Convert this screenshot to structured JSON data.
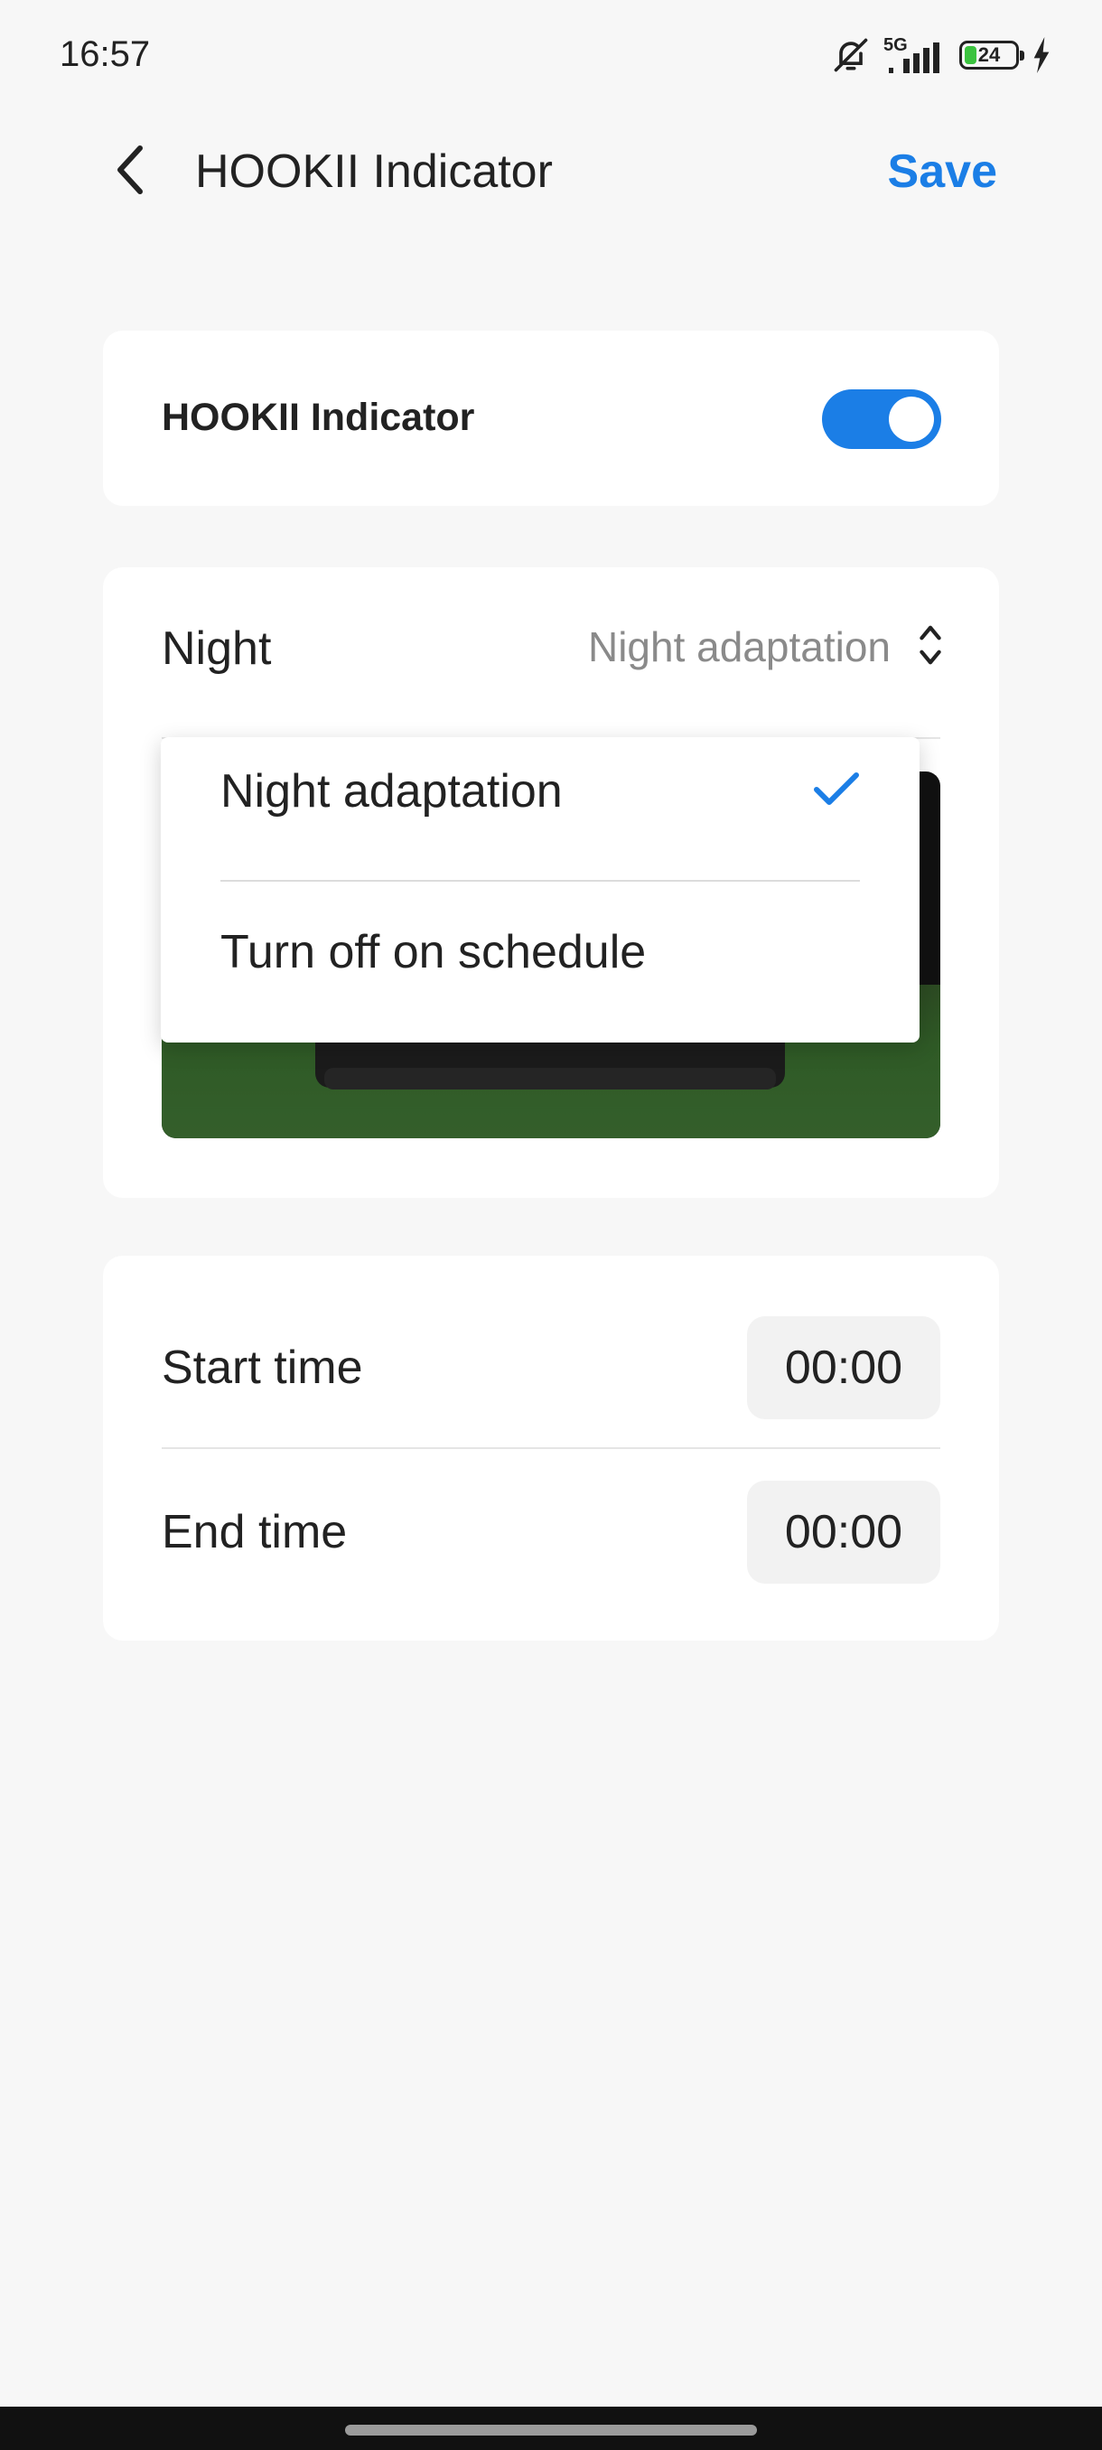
{
  "status_bar": {
    "time": "16:57",
    "network": "5G",
    "battery_level": "24",
    "icons": [
      "bell-muted-icon",
      "signal-icon",
      "battery-icon",
      "charging-icon"
    ]
  },
  "header": {
    "title": "HOOKII Indicator",
    "save_label": "Save",
    "back_icon": "chevron-left-icon"
  },
  "indicator_card": {
    "label": "HOOKII Indicator",
    "enabled": true
  },
  "night_card": {
    "label": "Night",
    "selected_value": "Night adaptation",
    "select_icon": "chevron-up-down-icon"
  },
  "dropdown": {
    "options": [
      {
        "label": "Night adaptation",
        "selected": true
      },
      {
        "label": "Turn off on schedule",
        "selected": false
      }
    ]
  },
  "time_card": {
    "start_label": "Start time",
    "start_value": "00:00",
    "end_label": "End time",
    "end_value": "00:00"
  },
  "colors": {
    "accent": "#1b7ee6",
    "background": "#f7f7f7",
    "card": "#ffffff",
    "battery_fill": "#3bc33f"
  }
}
